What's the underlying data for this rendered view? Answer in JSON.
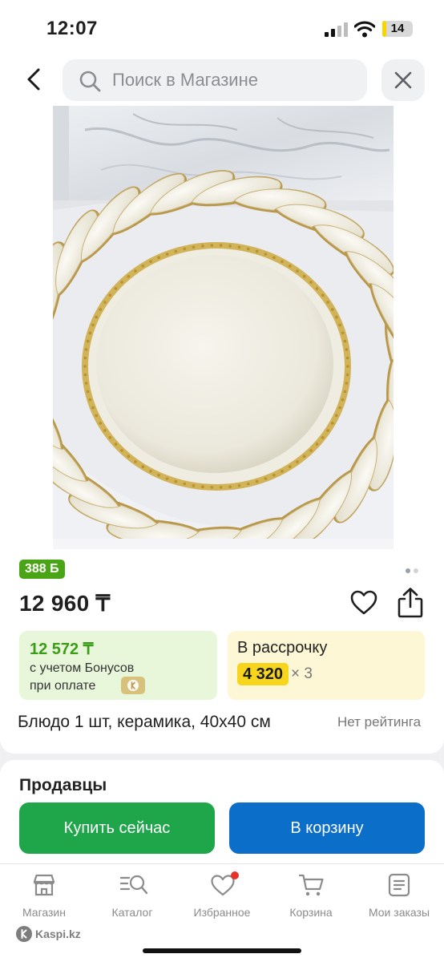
{
  "status_bar": {
    "time": "12:07",
    "battery": "14",
    "battery_level": 0.14
  },
  "header": {
    "search_placeholder": "Поиск в Магазине",
    "icons": [
      "back-chevron-icon",
      "search-icon",
      "close-icon"
    ]
  },
  "product": {
    "image_pager": {
      "total": 2,
      "active": 1
    },
    "bonus_badge": "388 Б",
    "price": "12 960 ₸",
    "bonus_price": "12 572 ₸",
    "bonus_line1": "с учетом Бонусов",
    "bonus_line2": "при оплате",
    "installment_title": "В рассрочку",
    "installment_amount": "4 320",
    "installment_times": "× 3",
    "title": "Блюдо 1 шт, керамика, 40x40 см",
    "rating": "Нет рейтинга"
  },
  "sellers": {
    "title": "Продавцы",
    "buy_now": "Купить сейчас",
    "add_to_cart": "В корзину"
  },
  "tab_bar": {
    "items": [
      {
        "label": "Магазин",
        "icon": "store-icon"
      },
      {
        "label": "Каталог",
        "icon": "catalog-icon"
      },
      {
        "label": "Избранное",
        "icon": "heart-icon"
      },
      {
        "label": "Корзина",
        "icon": "cart-icon"
      },
      {
        "label": "Мои заказы",
        "icon": "orders-icon"
      }
    ]
  },
  "brand": "Kaspi.kz",
  "colors": {
    "green": "#1fa64a",
    "blue": "#0b6ec8",
    "yellow": "#f7d51d",
    "badge_green": "#4aa516",
    "notification_red": "#e5332a"
  }
}
